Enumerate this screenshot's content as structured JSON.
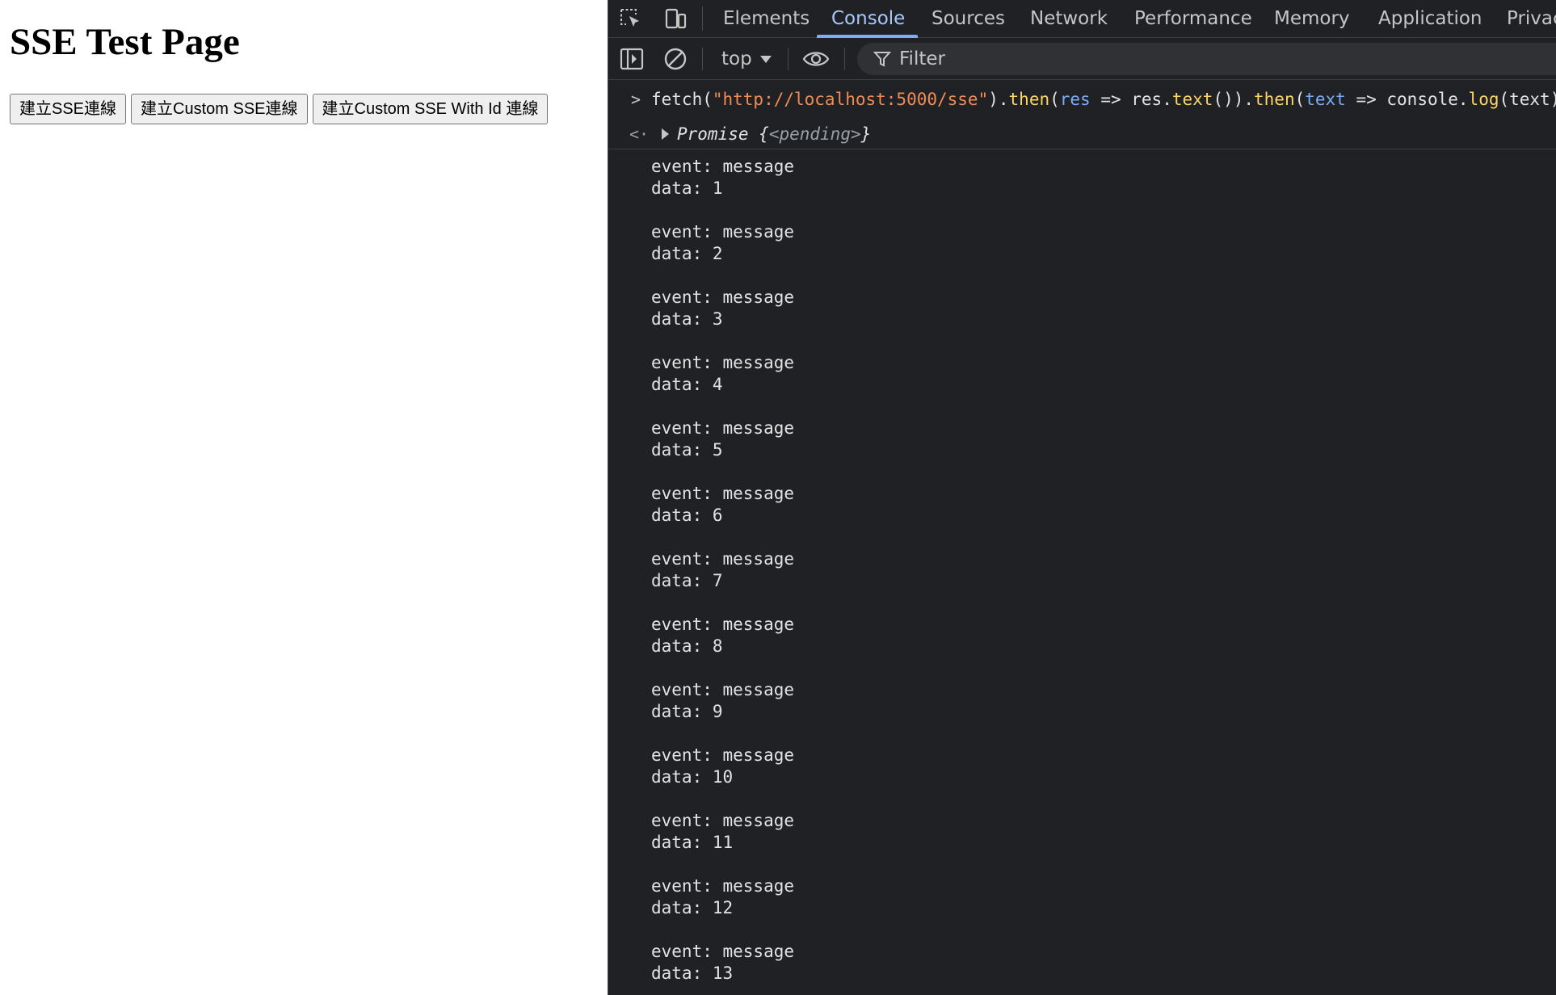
{
  "page": {
    "title": "SSE Test Page",
    "buttons": [
      {
        "label": "建立SSE連線"
      },
      {
        "label": "建立Custom SSE連線"
      },
      {
        "label": "建立Custom SSE With Id 連線"
      }
    ]
  },
  "devtools": {
    "tabs": [
      {
        "label": "Elements"
      },
      {
        "label": "Console"
      },
      {
        "label": "Sources"
      },
      {
        "label": "Network"
      },
      {
        "label": "Performance"
      },
      {
        "label": "Memory"
      },
      {
        "label": "Application"
      },
      {
        "label": "Privac"
      }
    ],
    "active_tab": "Console",
    "toolbar": {
      "context": "top",
      "filter_placeholder": "Filter"
    },
    "console": {
      "input": {
        "t1": "fetch(",
        "t2": "\"http://localhost:5000/sse\"",
        "t3": ").",
        "t4": "then",
        "t5": "(",
        "t6": "res",
        "t7": " => res.",
        "t8": "text",
        "t9": "()).",
        "t10": "then",
        "t11": "(",
        "t12": "text",
        "t13": " => console.",
        "t14": "log",
        "t15": "(text))"
      },
      "result": {
        "type": "Promise",
        "open": "{",
        "state": "<pending>",
        "close": "}"
      },
      "log_output": "event: message\ndata: 1\n\nevent: message\ndata: 2\n\nevent: message\ndata: 3\n\nevent: message\ndata: 4\n\nevent: message\ndata: 5\n\nevent: message\ndata: 6\n\nevent: message\ndata: 7\n\nevent: message\ndata: 8\n\nevent: message\ndata: 9\n\nevent: message\ndata: 10\n\nevent: message\ndata: 11\n\nevent: message\ndata: 12\n\nevent: message\ndata: 13"
    },
    "colors": {
      "background": "#202124",
      "accent": "#a8c7fa",
      "string": "#f28b54",
      "function": "#fdd663",
      "variable": "#7cacf8"
    },
    "icons": [
      "inspect-element-icon",
      "device-toolbar-icon",
      "sidebar-toggle-icon",
      "clear-console-icon",
      "live-expression-eye-icon",
      "filter-funnel-icon"
    ]
  }
}
